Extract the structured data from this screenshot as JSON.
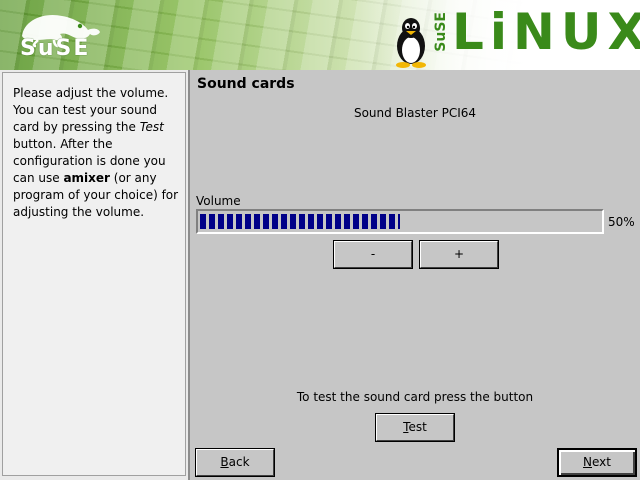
{
  "header": {
    "suse_wordmark": "SuSE",
    "brand_suse": "SuSE",
    "brand_linux": "LiNUX"
  },
  "help": {
    "text_1": "Please adjust the volume. You can test your sound card by pressing the ",
    "text_test": "Test",
    "text_2": " button. After the configuration is done you can use ",
    "text_amixer": "amixer",
    "text_3": " (or any program of your choice) for adjusting the volume."
  },
  "main": {
    "title": "Sound cards",
    "card_name": "Sound Blaster PCI64",
    "volume_label": "Volume",
    "volume_value": 0.5,
    "volume_percent": "50%",
    "minus_label": "-",
    "plus_label": "+",
    "test_hint": "To test the sound card press the button",
    "test_first": "T",
    "test_rest": "est"
  },
  "nav": {
    "back_first": "B",
    "back_rest": "ack",
    "next_first": "N",
    "next_rest": "ext"
  },
  "colors": {
    "brand_green": "#3a8a1a",
    "progress_blue": "#000088",
    "panel_gray": "#c6c6c6"
  }
}
